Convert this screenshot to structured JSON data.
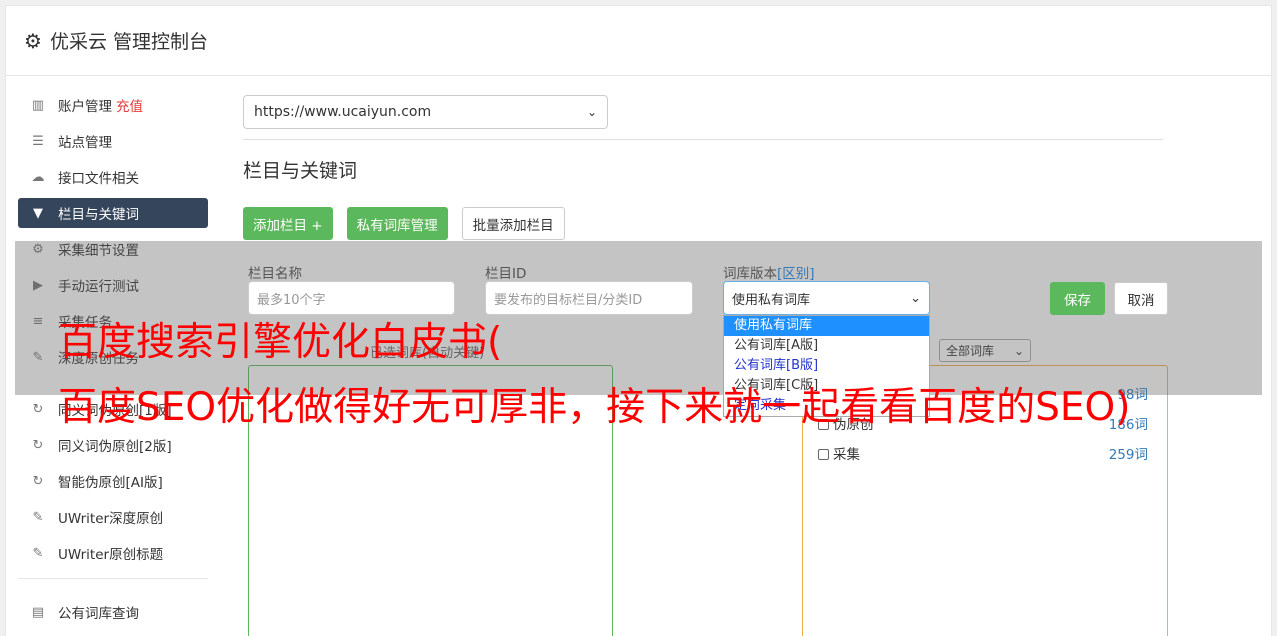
{
  "header": {
    "title": "优采云 管理控制台",
    "icon": "gear-icon"
  },
  "sidebar": {
    "items": [
      {
        "label": "账户管理",
        "badge": "充值",
        "icon": "bar-chart-icon"
      },
      {
        "label": "站点管理",
        "icon": "server-icon"
      },
      {
        "label": "接口文件相关",
        "icon": "cloud-upload-icon"
      },
      {
        "label": "栏目与关键词",
        "icon": "filter-icon",
        "active": true
      },
      {
        "label": "采集细节设置",
        "icon": "cogs-icon"
      },
      {
        "label": "手动运行测试",
        "icon": "play-icon"
      },
      {
        "label": "采集任务",
        "icon": "database-icon"
      },
      {
        "label": "深度原创任务",
        "icon": "edit-icon"
      },
      {
        "label": "同义词伪原创[1版]",
        "icon": "refresh-icon"
      },
      {
        "label": "同义词伪原创[2版]",
        "icon": "refresh-icon"
      },
      {
        "label": "智能伪原创[AI版]",
        "icon": "refresh-icon"
      },
      {
        "label": "UWriter深度原创",
        "icon": "edit-icon"
      },
      {
        "label": "UWriter原创标题",
        "icon": "edit-icon"
      },
      {
        "label": "公有词库查询",
        "icon": "book-icon"
      }
    ]
  },
  "main": {
    "site_select": "https://www.ucaiyun.com",
    "section_title": "栏目与关键词",
    "buttons": {
      "add_column": "添加栏目 +",
      "private_lib": "私有词库管理",
      "batch_add": "批量添加栏目"
    },
    "form": {
      "name_label": "栏目名称",
      "name_placeholder": "最多10个字",
      "id_label": "栏目ID",
      "id_placeholder": "要发布的目标栏目/分类ID",
      "version_label": "词库版本",
      "version_link": "[区别]",
      "version_value": "使用私有词库",
      "save": "保存",
      "cancel": "取消"
    },
    "version_options": [
      "使用私有词库",
      "公有词库[A版]",
      "公有词库[B版]",
      "公有词库[C版]",
      "定向采集"
    ],
    "lib_hint": "已选词库(自动关键)",
    "lib_filter": "全部词库",
    "libs": [
      {
        "label": "原创",
        "count": "98词"
      },
      {
        "label": "伪原创",
        "count": "186词"
      },
      {
        "label": "采集",
        "count": "259词"
      }
    ]
  },
  "watermark": {
    "line1": "百度搜索引擎优化白皮书(",
    "line2": "百度SEO优化做得好无可厚非，接下来就一起看看百度的SEO)"
  }
}
